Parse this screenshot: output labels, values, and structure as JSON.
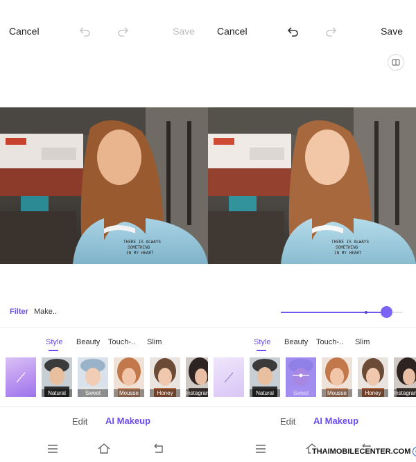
{
  "left_pane": {
    "header": {
      "cancel_label": "Cancel",
      "save_label": "Save"
    },
    "filter_tab": "Filter",
    "makeup_tab": "Make..",
    "slider": {
      "value_percent": 87,
      "marker_percent": 70
    },
    "category_tabs": [
      "Style",
      "Beauty",
      "Touch-..",
      "Slim"
    ],
    "active_category": "Style",
    "looks": [
      "",
      "Natural",
      "Sweet",
      "Mousse",
      "Honey",
      "Instagram"
    ],
    "modes": {
      "edit_label": "Edit",
      "ai_makeup_label": "AI Makeup"
    }
  },
  "right_pane": {
    "header": {
      "cancel_label": "Cancel",
      "save_label": "Save"
    },
    "category_tabs": [
      "Style",
      "Beauty",
      "Touch-..",
      "Slim"
    ],
    "active_category": "Style",
    "looks": [
      "",
      "Natural",
      "Sweet",
      "Mousse",
      "Honey",
      "Instagram"
    ],
    "selected_look": "Sweet",
    "modes": {
      "edit_label": "Edit",
      "ai_makeup_label": "AI Makeup"
    }
  },
  "watermark": {
    "text": "THAIMOBILECENTER.COM",
    "symbol": "©"
  },
  "colors": {
    "accent": "#6b4cf0",
    "save_disabled": "#bdbdbd",
    "save_enabled": "#222222"
  },
  "icons": [
    "undo-icon",
    "redo-icon",
    "compare-icon",
    "menu-icon",
    "home-icon",
    "back-icon"
  ]
}
